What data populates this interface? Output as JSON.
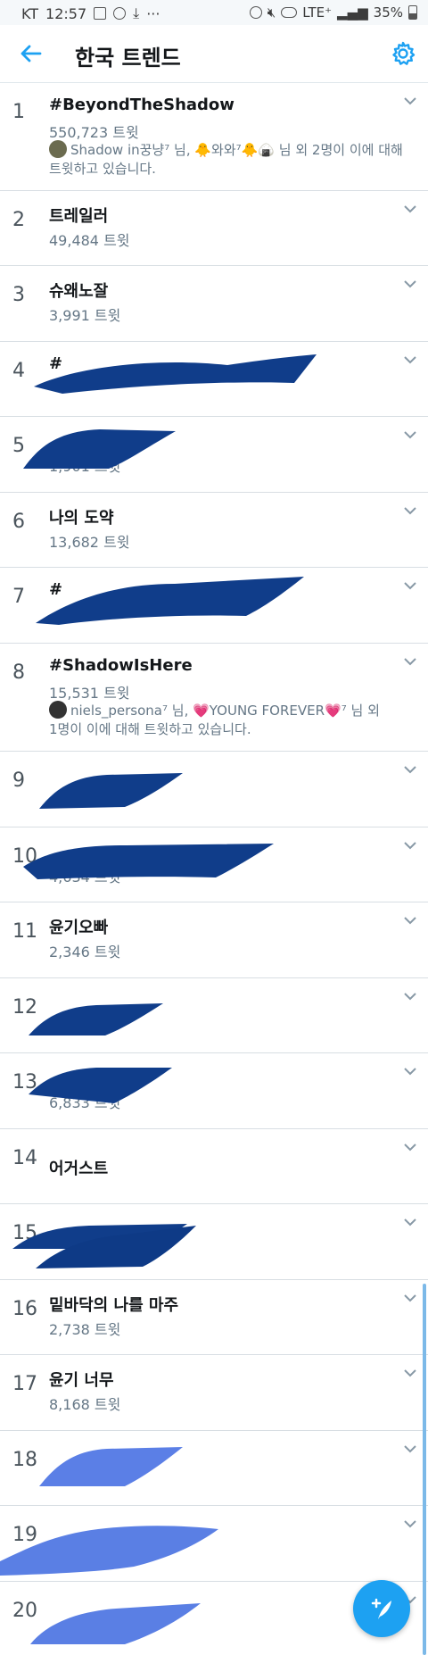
{
  "status_bar": {
    "carrier": "KT",
    "time": "12:57",
    "network": "LTE⁺",
    "battery": "35%",
    "icons": [
      "image-icon",
      "circle-icon",
      "download-icon",
      "more-icon",
      "alarm-icon",
      "mute-icon",
      "hd-icon",
      "signal-icon",
      "battery-icon"
    ]
  },
  "header": {
    "title": "한국 트렌드",
    "back_icon": "arrow-left-icon",
    "settings_icon": "gear-icon",
    "accent": "#1da1f2"
  },
  "trends": [
    {
      "rank": "1",
      "name": "#BeyondTheShadow",
      "count": "550,723 트윗",
      "context_user": "Shadow in꿍냥⁷",
      "context_line1": "님, 🐥와와⁷🐥🍙 님 외 2명이 이에 대해",
      "context_line2": "트윗하고 있습니다."
    },
    {
      "rank": "2",
      "name": "트레일러",
      "count": "49,484 트윗"
    },
    {
      "rank": "3",
      "name": "슈왜노잘",
      "count": "3,991 트윗"
    },
    {
      "rank": "4",
      "name": "#",
      "count": ""
    },
    {
      "rank": "5",
      "name": "",
      "count": "1,901 트윗"
    },
    {
      "rank": "6",
      "name": "나의 도약",
      "count": "13,682 트윗"
    },
    {
      "rank": "7",
      "name": "#",
      "count": ""
    },
    {
      "rank": "8",
      "name": "#ShadowIsHere",
      "count": "15,531 트윗",
      "context_user": "niels_persona⁷",
      "context_line1": "님, 💗YOUNG FOREVER💗⁷ 님 외",
      "context_line2": "1명이 이에 대해 트윗하고 있습니다."
    },
    {
      "rank": "9",
      "name": "",
      "count": ""
    },
    {
      "rank": "10",
      "name": "",
      "count": "4,634 트윗"
    },
    {
      "rank": "11",
      "name": "윤기오빠",
      "count": "2,346 트윗"
    },
    {
      "rank": "12",
      "name": "",
      "count": ""
    },
    {
      "rank": "13",
      "name": "",
      "count": "6,833 트윗"
    },
    {
      "rank": "14",
      "name": "어거스트",
      "count": ""
    },
    {
      "rank": "15",
      "name": "",
      "count": ""
    },
    {
      "rank": "16",
      "name": "밑바닥의 나를 마주",
      "count": "2,738 트윗"
    },
    {
      "rank": "17",
      "name": "윤기 너무",
      "count": "8,168 트윗"
    },
    {
      "rank": "18",
      "name": "",
      "count": ""
    },
    {
      "rank": "19",
      "name": "",
      "count": ""
    },
    {
      "rank": "20",
      "name": "",
      "count": ""
    }
  ],
  "fab": {
    "icon": "compose-tweet-icon",
    "color": "#1da1f2"
  }
}
